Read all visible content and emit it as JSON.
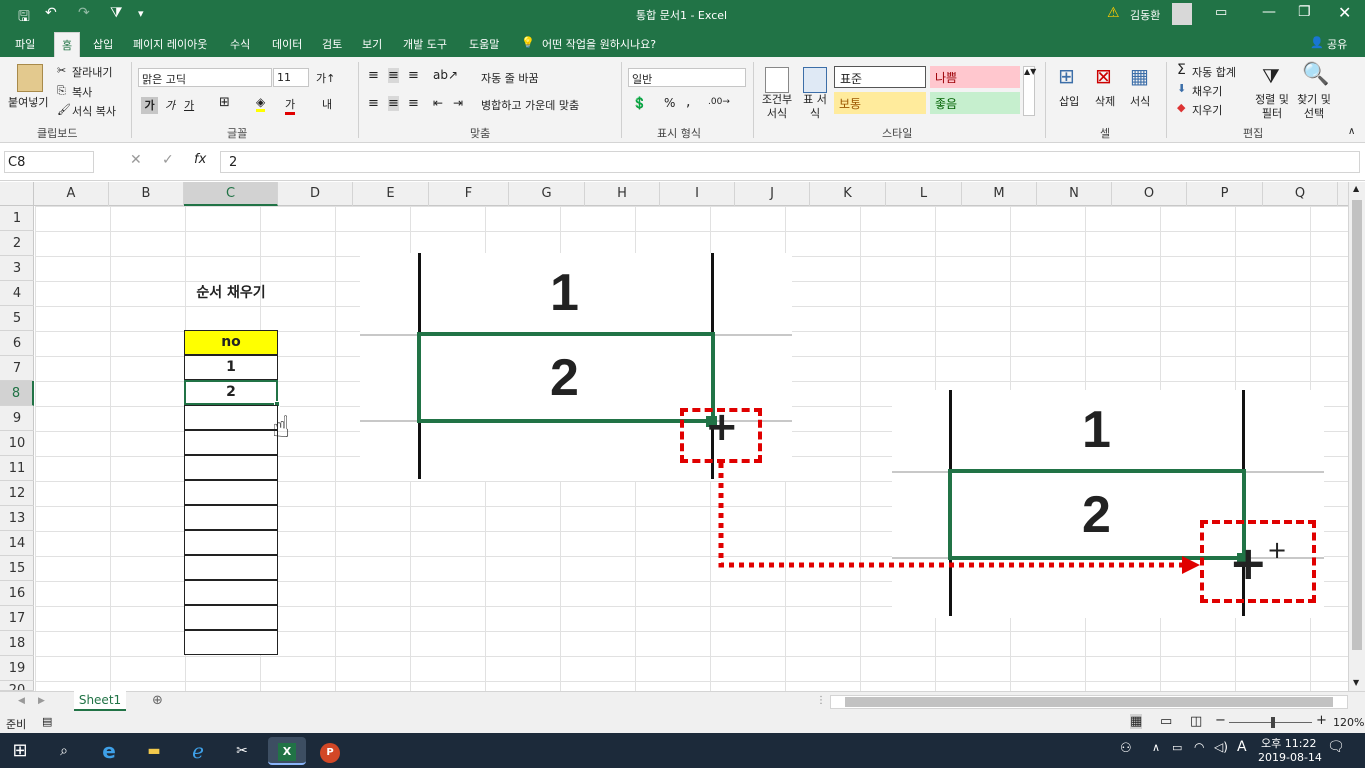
{
  "title_bar": {
    "doc_title": "통합 문서1  -  Excel",
    "user_name": "김동환",
    "qat_more": "▾"
  },
  "tabs": [
    "파일",
    "홈",
    "삽입",
    "페이지 레이아웃",
    "수식",
    "데이터",
    "검토",
    "보기",
    "개발 도구",
    "도움말"
  ],
  "tell_me": "어떤 작업을 원하시나요?",
  "share": "공유",
  "ribbon": {
    "clipboard": {
      "paste": "붙여넣기",
      "cut": "잘라내기",
      "copy": "복사",
      "format_painter": "서식 복사",
      "group": "클립보드"
    },
    "font": {
      "font_name": "맑은 고딕",
      "font_size": "11",
      "bold": "가",
      "italic": "가",
      "underline": "가",
      "font_color": "가",
      "group": "글꼴"
    },
    "align": {
      "wrap": "자동 줄 바꿈",
      "merge": "병합하고 가운데 맞춤",
      "group": "맞춤"
    },
    "number": {
      "format": "일반",
      "percent": "%",
      "comma": ",",
      "group": "표시 형식"
    },
    "styles": {
      "cond": "조건부 서식",
      "table": "표 서식",
      "normal": "표준",
      "bad": "나쁨",
      "neutral": "보통",
      "good": "좋음",
      "group": "스타일"
    },
    "cells": {
      "insert": "삽입",
      "delete": "삭제",
      "format": "서식",
      "group": "셀"
    },
    "editing": {
      "autosum": "자동 합계",
      "fill": "채우기",
      "clear": "지우기",
      "sort": "정렬 및 필터",
      "find": "찾기 및 선택",
      "group": "편집"
    }
  },
  "formula_bar": {
    "name_box": "C8",
    "content": "2",
    "fx": "fx"
  },
  "columns": [
    "A",
    "B",
    "C",
    "D",
    "E",
    "F",
    "G",
    "H",
    "I",
    "J",
    "K",
    "L",
    "M",
    "N",
    "O",
    "P",
    "Q"
  ],
  "rows": [
    "1",
    "2",
    "3",
    "4",
    "5",
    "6",
    "7",
    "8",
    "9",
    "10",
    "11",
    "12",
    "13",
    "14",
    "15",
    "16",
    "17",
    "18",
    "19",
    "20"
  ],
  "cells": {
    "C4": "순서 채우기",
    "C6": "no",
    "C7": "1",
    "C8": "2"
  },
  "zoom_images": {
    "left_top": "1",
    "left_bottom": "2",
    "right_top": "1",
    "right_bottom": "2"
  },
  "sheet_tab": "Sheet1",
  "status": {
    "ready": "준비",
    "zoom": "120%"
  },
  "taskbar": {
    "time": "오후 11:22",
    "date": "2019-08-14",
    "ime": "A"
  },
  "colors": {
    "excel_green": "#217346",
    "highlight_yellow": "#ffff00",
    "arrow_red": "#e00000"
  }
}
